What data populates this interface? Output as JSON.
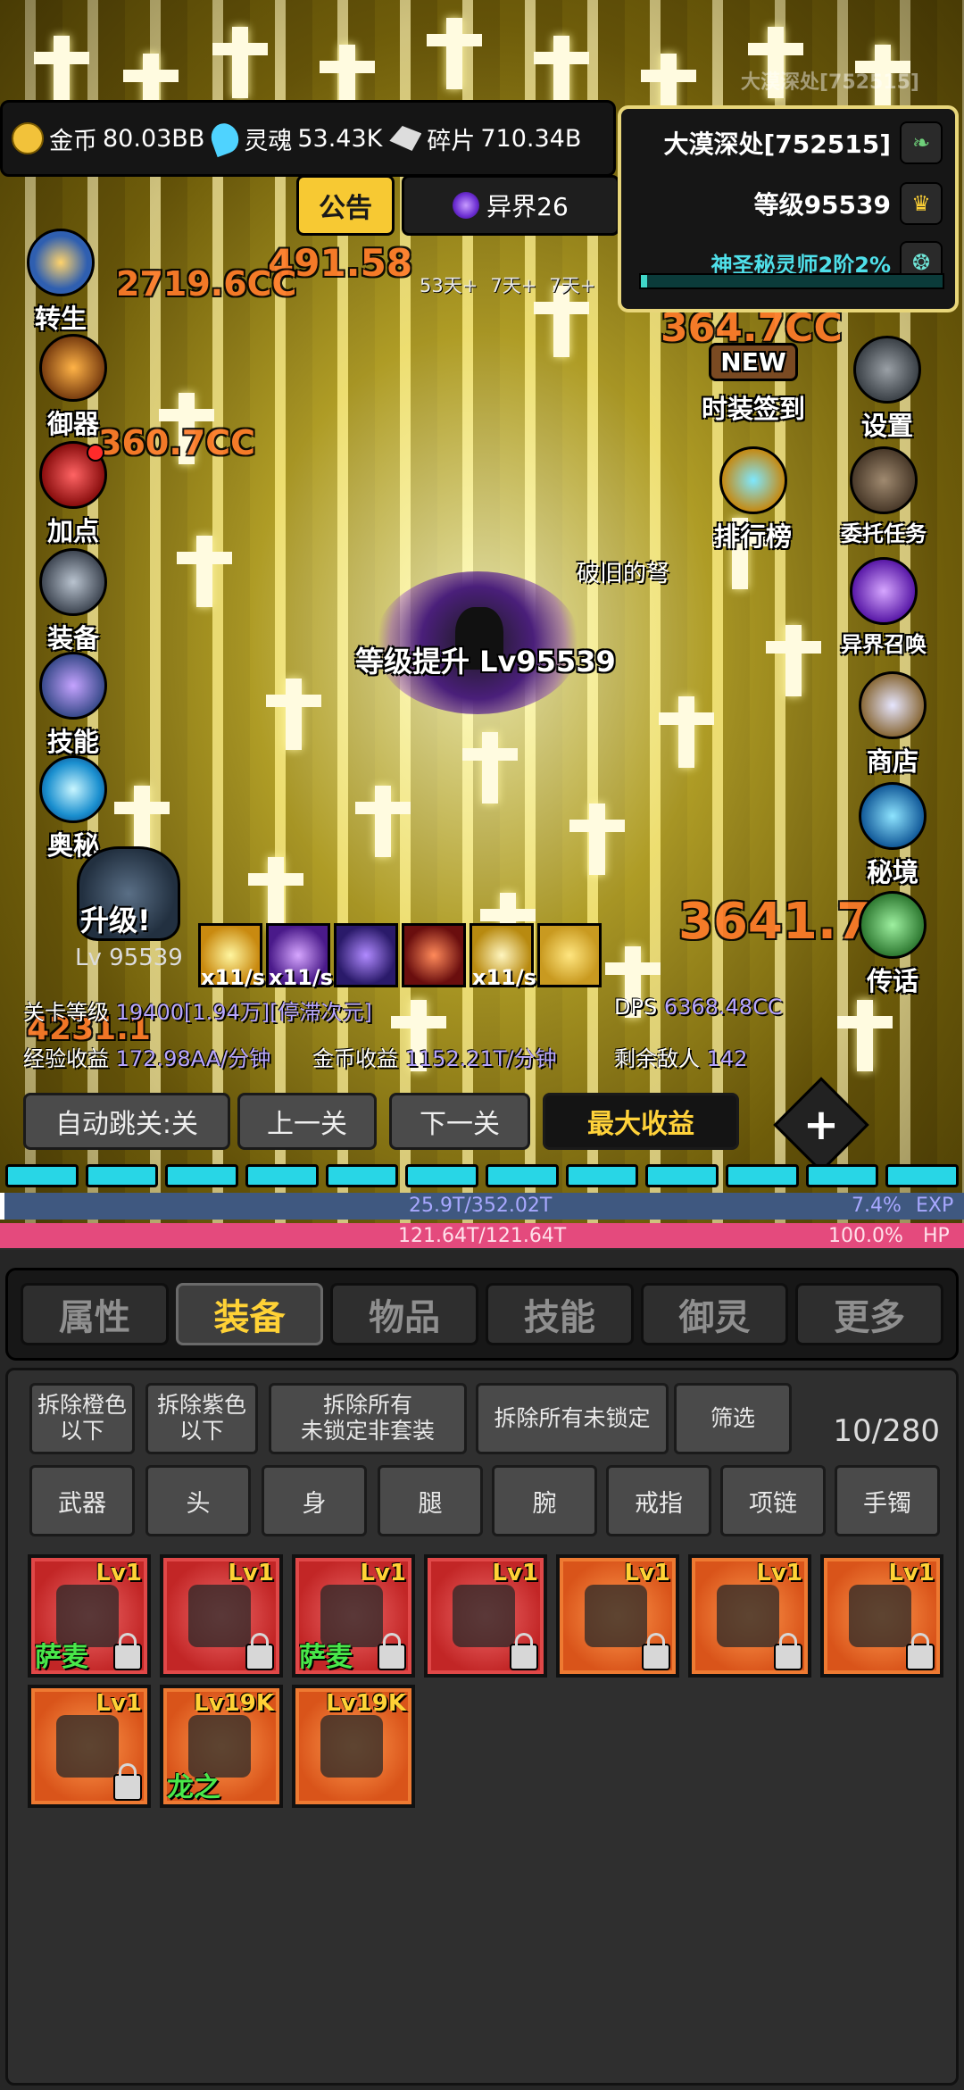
{
  "resources": {
    "gold_label": "金币",
    "gold_value": "80.03BB",
    "soul_label": "灵魂",
    "soul_value": "53.43K",
    "shard_label": "碎片",
    "shard_value": "710.34B"
  },
  "header": {
    "notice_label": "公告",
    "realm_label": "异界26",
    "area_ghost": "大漠深处[752515]"
  },
  "info_panel": {
    "area": "大漠深处[752515]",
    "level": "等级95539",
    "rank": "神圣秘灵师2阶2%",
    "rank_progress": 0.02
  },
  "left_menu": [
    "转生",
    "御器",
    "加点",
    "装备",
    "技能",
    "奥秘"
  ],
  "right_menu": [
    "时装签到",
    "设置",
    "排行榜",
    "委托任务",
    "异界召唤",
    "商店",
    "秘境",
    "传话"
  ],
  "event_badge": "NEW",
  "buff_timers": [
    "53天+",
    "7天+",
    "7天+"
  ],
  "battle": {
    "levelup_text": "等级提升 Lv95539",
    "item_drop": "破旧的弩",
    "boss_upgrade": "升级!",
    "boss_level": "Lv 95539",
    "skill_rates": [
      "x11/s",
      "x11/s",
      "",
      "",
      "x11/s",
      ""
    ],
    "damage_numbers": [
      "491.58",
      "360.7CC",
      "364.7CC",
      "3641.7",
      "4231.1",
      "2719.6CC"
    ]
  },
  "stats": {
    "stage_label": "关卡等级",
    "stage_value": "19400[1.94万][停滞次元]",
    "dps_label": "DPS",
    "dps_value": "6368.48CC",
    "exp_label": "经验收益",
    "exp_value": "172.98AA/分钟",
    "gold_label": "金币收益",
    "gold_value": "1152.21T/分钟",
    "enemy_label": "剩余敌人",
    "enemy_value": "142"
  },
  "controls": {
    "auto_skip": "自动跳关:关",
    "prev": "上一关",
    "next": "下一关",
    "max_profit": "最大收益",
    "plus": "+"
  },
  "exp_bar": {
    "text": "25.9T/352.02T",
    "percent": "7.4%",
    "label": "EXP",
    "fill": 0.074
  },
  "hp_bar": {
    "text": "121.64T/121.64T",
    "percent": "100.0%",
    "label": "HP",
    "fill": 1.0
  },
  "tabs": [
    "属性",
    "装备",
    "物品",
    "技能",
    "御灵",
    "更多"
  ],
  "active_tab": "装备",
  "actions": {
    "dismantle_orange": "拆除橙色\n以下",
    "dismantle_purple": "拆除紫色\n以下",
    "dismantle_all_unlocked_nonset": "拆除所有\n未锁定非套装",
    "dismantle_all_unlocked": "拆除所有未锁定",
    "filter": "筛选",
    "count": "10/280"
  },
  "slots": [
    "武器",
    "头",
    "身",
    "腿",
    "腕",
    "戒指",
    "项链",
    "手镯"
  ],
  "items": [
    {
      "level": "Lv1",
      "set": "萨麦",
      "rarity": "red"
    },
    {
      "level": "Lv1",
      "set": "",
      "rarity": "red"
    },
    {
      "level": "Lv1",
      "set": "萨麦",
      "rarity": "red"
    },
    {
      "level": "Lv1",
      "set": "",
      "rarity": "red"
    },
    {
      "level": "Lv1",
      "set": "",
      "rarity": "orange"
    },
    {
      "level": "Lv1",
      "set": "",
      "rarity": "orange"
    },
    {
      "level": "Lv1",
      "set": "",
      "rarity": "orange"
    },
    {
      "level": "Lv1",
      "set": "",
      "rarity": "orange"
    },
    {
      "level": "Lv19K",
      "set": "龙之",
      "rarity": "orange"
    },
    {
      "level": "Lv19K",
      "set": "",
      "rarity": "orange"
    }
  ],
  "colors": {
    "accent": "#ffd236",
    "exp": "#3f5880",
    "hp": "#e44a7d",
    "cyan": "#28d6e6"
  }
}
